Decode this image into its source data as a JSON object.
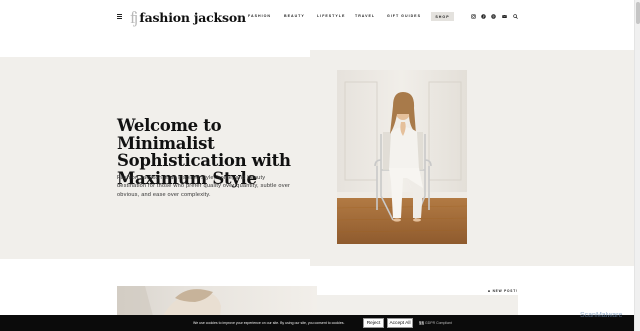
{
  "header": {
    "logo_mark": "fj",
    "logo_text": "fashion jackson",
    "nav": [
      "FASHION",
      "BEAUTY",
      "LIFESTYLE",
      "TRAVEL",
      "GIFT GUIDES"
    ],
    "shop_label": "SHOP",
    "social_icons": [
      "instagram-icon",
      "pinterest-icon",
      "spotify-icon",
      "email-icon",
      "search-icon"
    ]
  },
  "hero": {
    "title": "Welcome to Minimalist Sophistication with Maximum Style",
    "description": "Fashion Jackson is an inspired style, home, and beauty destination for those who prefer quality over quantity, subtle over obvious, and ease over complexity."
  },
  "lower": {
    "badge": "■ NEW POST!"
  },
  "cookie": {
    "text": "We use cookies to improve your experience on our site. By using our site, you consent to cookies.",
    "reject_label": "Reject",
    "accept_label": "Accept All",
    "gdpr_mark": "§§",
    "gdpr_text": "GDPR Compliant"
  },
  "watermark": "ScanMalware",
  "colors": {
    "hero_bg": "#f1efeb",
    "cookie_bg": "#0b0b0b",
    "shop_bg": "#e4e2de"
  }
}
